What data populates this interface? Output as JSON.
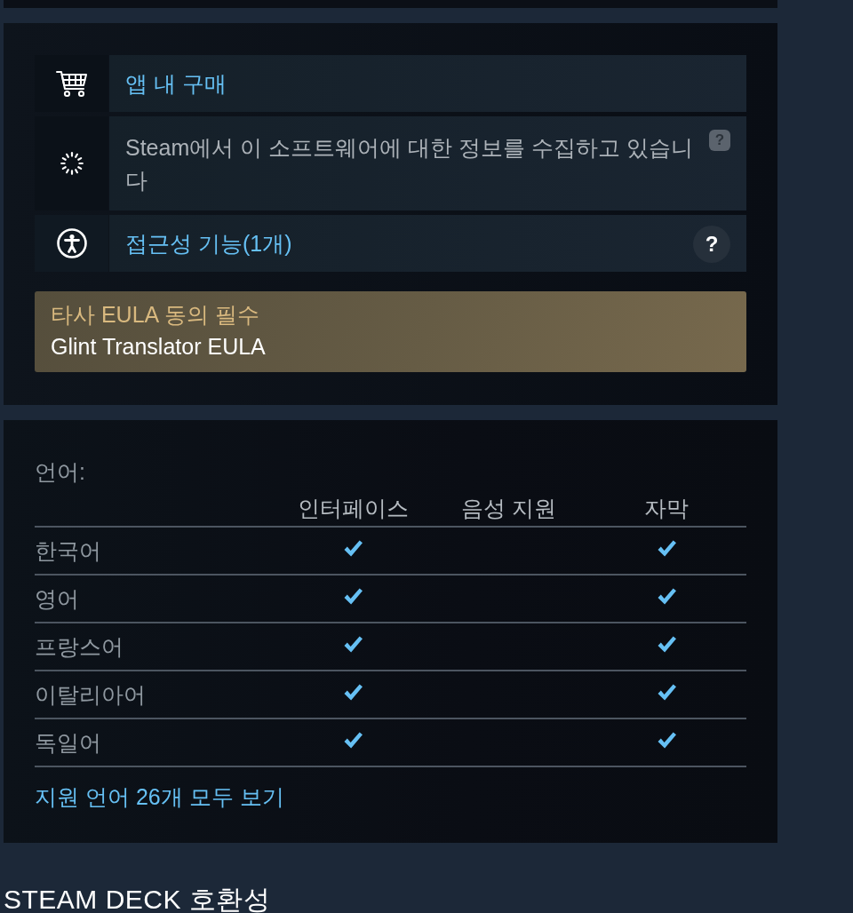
{
  "features": [
    {
      "kind": "purchase",
      "label": "앱 내 구매",
      "link": true
    },
    {
      "kind": "loading",
      "label": "Steam에서 이 소프트웨어에 대한 정보를 수집하고 있습니다",
      "link": false,
      "help": {
        "kind": "hint",
        "text": "?"
      }
    },
    {
      "kind": "accessibility",
      "label": "접근성 기능(1개)",
      "link": true,
      "help": {
        "kind": "button",
        "text": "?"
      }
    }
  ],
  "eula": {
    "title": "타사 EULA 동의 필수",
    "link": "Glint Translator EULA"
  },
  "languages": {
    "title": "언어:",
    "columns": [
      "인터페이스",
      "음성 지원",
      "자막"
    ],
    "rows": [
      {
        "name": "한국어",
        "interface": true,
        "audio": false,
        "subtitles": true
      },
      {
        "name": "영어",
        "interface": true,
        "audio": false,
        "subtitles": true
      },
      {
        "name": "프랑스어",
        "interface": true,
        "audio": false,
        "subtitles": true
      },
      {
        "name": "이탈리아어",
        "interface": true,
        "audio": false,
        "subtitles": true
      },
      {
        "name": "독일어",
        "interface": true,
        "audio": false,
        "subtitles": true
      }
    ],
    "more_link": "지원 언어 26개 모두 보기"
  },
  "section_heading": "STEAM DECK 호환성"
}
